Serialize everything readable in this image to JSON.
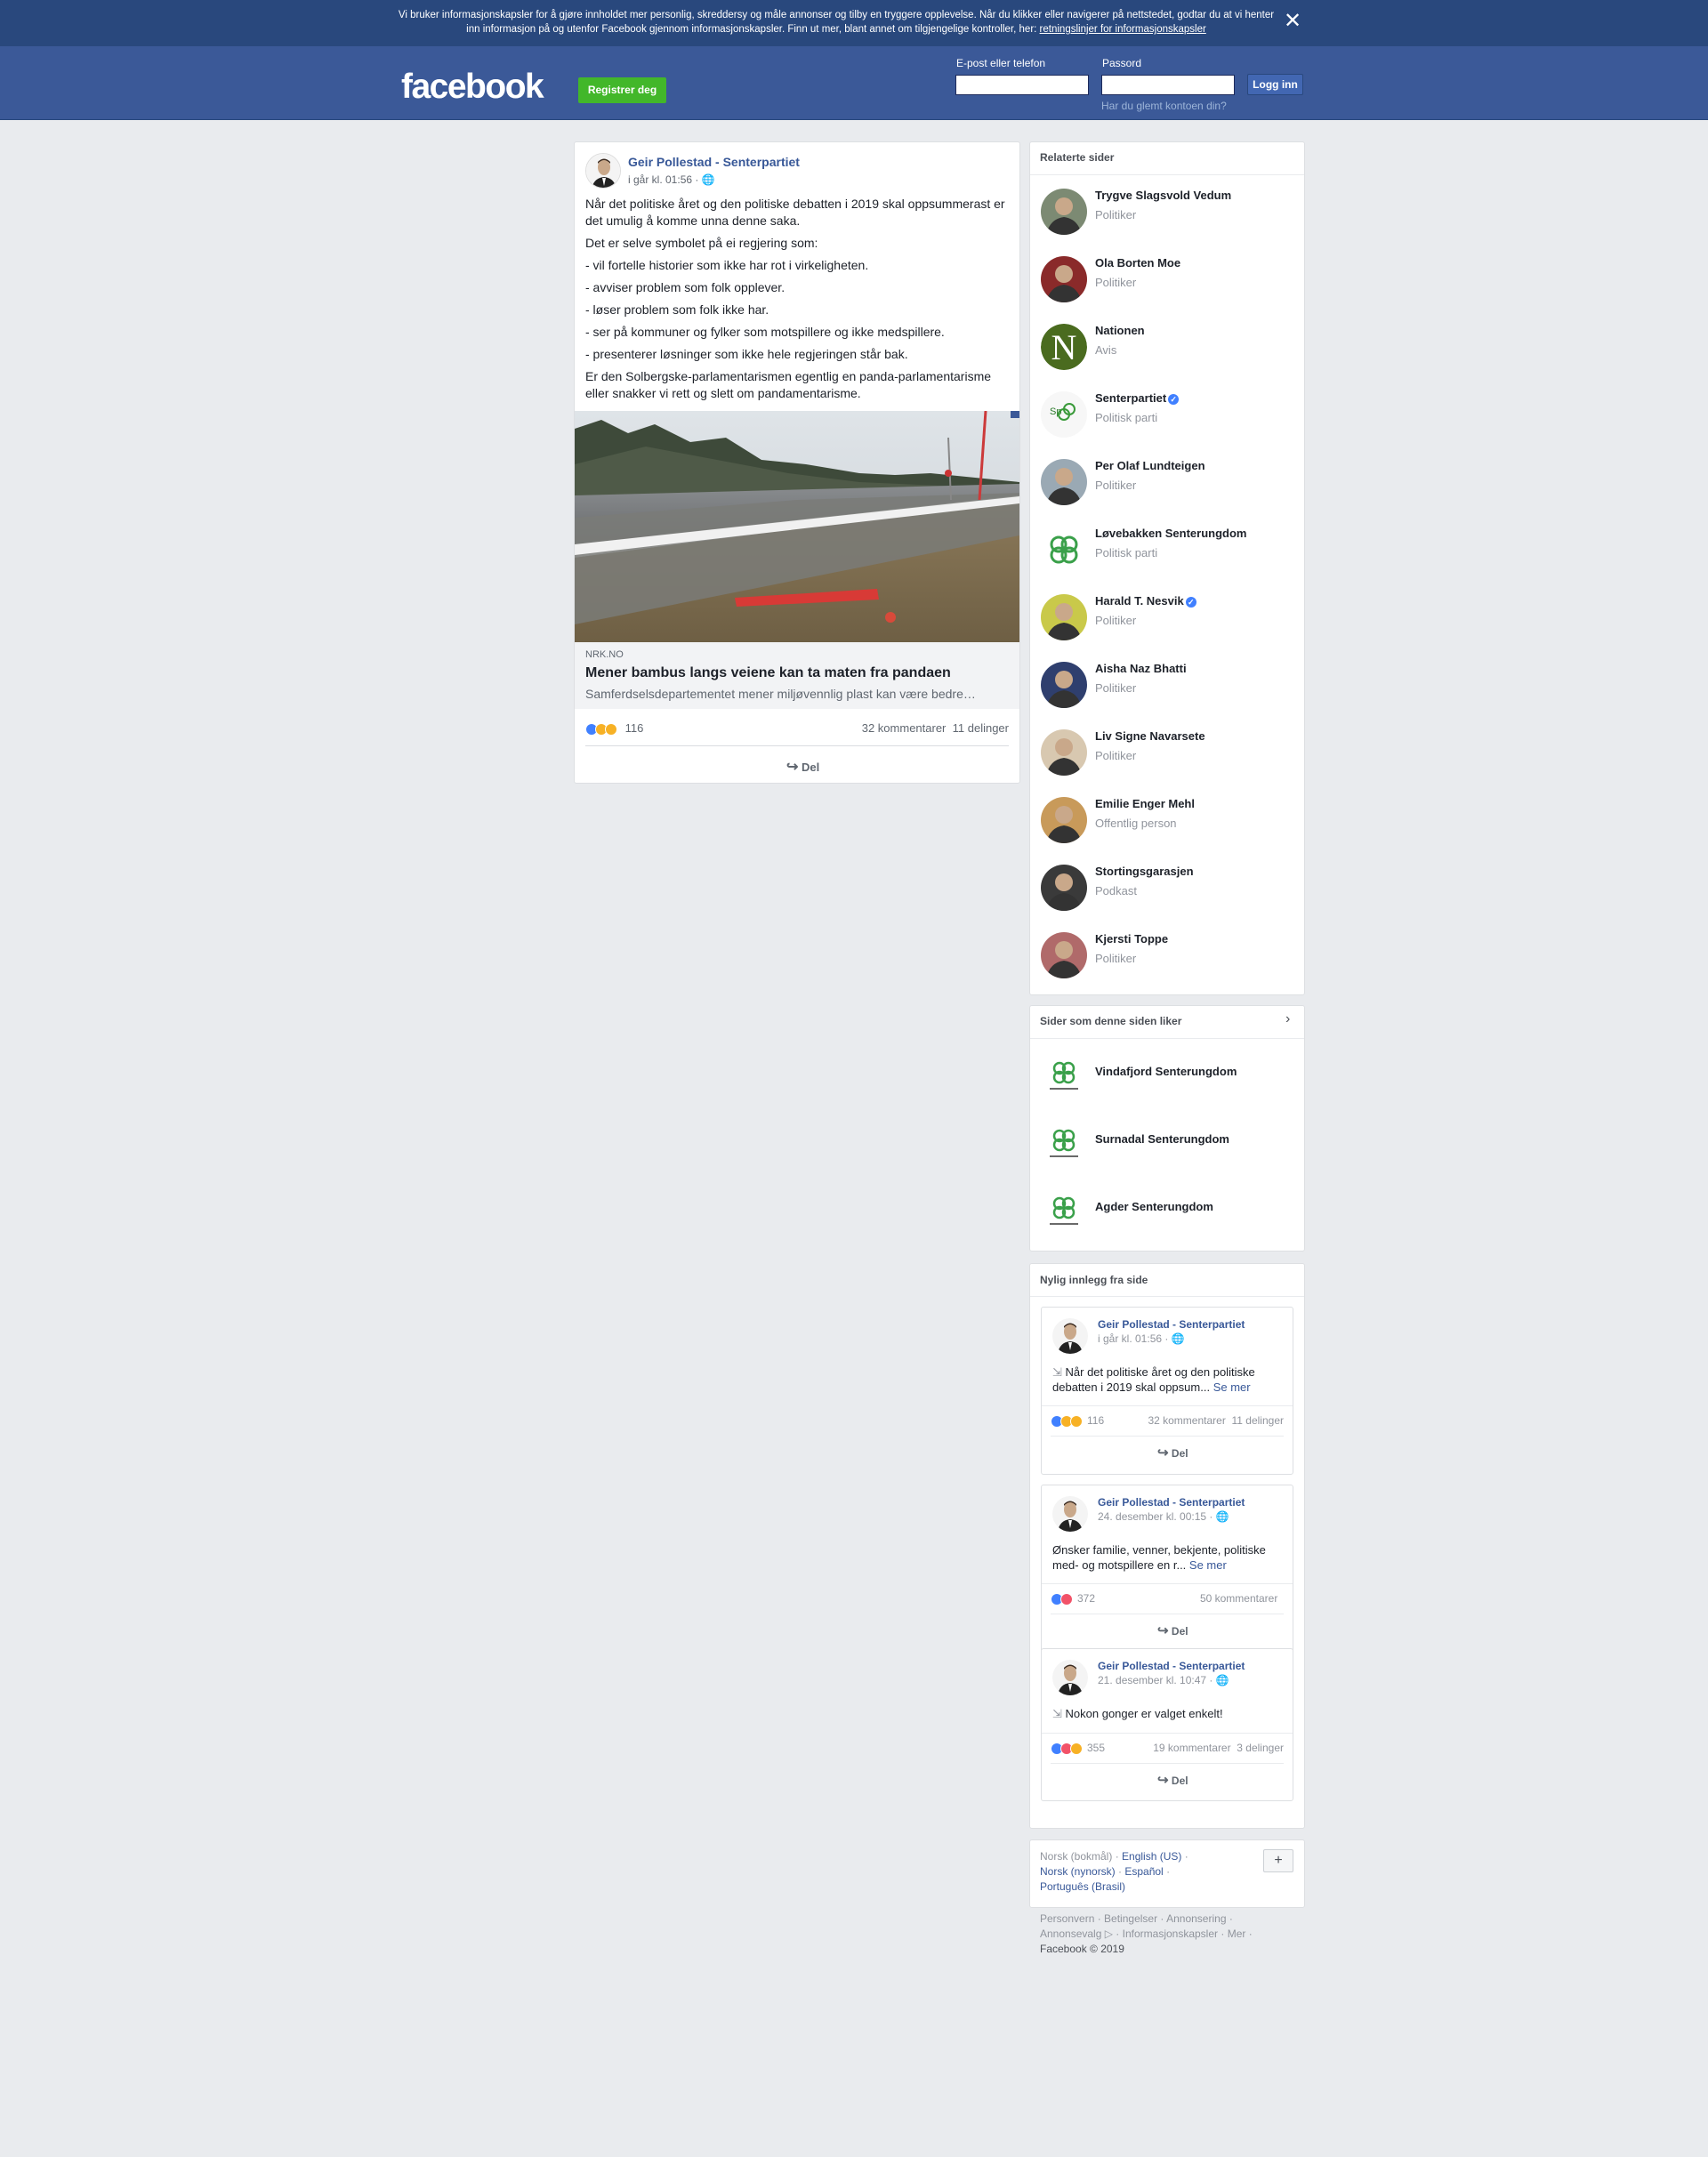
{
  "cookie_banner": {
    "text": "Vi bruker informasjonskapsler for å gjøre innholdet mer personlig, skreddersy og måle annonser og tilby en tryggere opplevelse. Når du klikker eller navigerer på nettstedet, godtar du at vi henter inn informasjon på og utenfor Facebook gjennom informasjonskapsler. Finn ut mer, blant annet om tilgjengelige kontroller, her: ",
    "link": "retningslinjer for informasjonskapsler"
  },
  "header": {
    "logo": "facebook",
    "register": "Registrer deg",
    "email_label": "E-post eller telefon",
    "password_label": "Passord",
    "login": "Logg inn",
    "forgot": "Har du glemt kontoen din?"
  },
  "post": {
    "author": "Geir Pollestad - Senterpartiet",
    "time": "i går kl. 01:56 · ",
    "paragraphs": [
      "Når det politiske året og den politiske debatten i 2019 skal oppsummerast er det umulig å komme unna denne saka.",
      "Det er selve symbolet på ei regjering som:",
      "- vil fortelle historier som ikke har rot i virkeligheten.",
      "- avviser problem som folk opplever.",
      "- løser problem som folk ikke har.",
      "- ser på kommuner og fylker som motspillere og ikke medspillere.",
      "- presenterer løsninger som ikke hele regjeringen står bak.",
      "Er den Solbergske-parlamentarismen egentlig en panda-parlamentarisme eller snakker vi rett og slett om pandamentarisme."
    ],
    "link": {
      "domain": "NRK.NO",
      "title": "Mener bambus langs veiene kan ta maten fra pandaen",
      "desc": "Samferdselsdepartementet mener miljøvennlig plast kan være bedre…"
    },
    "reactions": "116",
    "comments": "32 kommentarer",
    "shares": "11 delinger",
    "share_button": "Del"
  },
  "related": {
    "title": "Relaterte sider",
    "items": [
      {
        "name": "Trygve Slagsvold Vedum",
        "category": "Politiker",
        "color": "#7c8a73"
      },
      {
        "name": "Ola Borten Moe",
        "category": "Politiker",
        "color": "#8a2a2a"
      },
      {
        "name": "Nationen",
        "category": "Avis",
        "color": "#4a6b1f"
      },
      {
        "name": "Senterpartiet",
        "category": "Politisk parti",
        "color": "#f2f2f2"
      },
      {
        "name": "Per Olaf Lundteigen",
        "category": "Politiker",
        "color": "#9aa9b4"
      },
      {
        "name": "Løvebakken Senterungdom",
        "category": "Politisk parti",
        "color": "#ffffff"
      },
      {
        "name": "Harald T. Nesvik",
        "category": "Politiker",
        "color": "#c9c94a"
      },
      {
        "name": "Aisha Naz Bhatti",
        "category": "Politiker",
        "color": "#2f3f6e"
      },
      {
        "name": "Liv Signe Navarsete",
        "category": "Politiker",
        "color": "#d8c8b0"
      },
      {
        "name": "Emilie Enger Mehl",
        "category": "Offentlig person",
        "color": "#c89a5a"
      },
      {
        "name": "Stortingsgarasjen",
        "category": "Podkast",
        "color": "#3a3a3a"
      },
      {
        "name": "Kjersti Toppe",
        "category": "Politiker",
        "color": "#b06a6a"
      }
    ]
  },
  "liked_pages": {
    "title": "Sider som denne siden liker",
    "items": [
      {
        "name": "Vindafjord Senterungdom"
      },
      {
        "name": "Surnadal Senterungdom"
      },
      {
        "name": "Agder Senterungdom"
      }
    ]
  },
  "recent": {
    "title": "Nylig innlegg fra side",
    "posts": [
      {
        "author": "Geir Pollestad - Senterpartiet",
        "time": "i går kl. 01:56 · ",
        "text": " Når det politiske året og den politiske debatten i 2019 skal oppsum...",
        "see_more": "Se mer",
        "count": "116",
        "comments": "32 kommentarer",
        "shares": "11 delinger",
        "share": "Del"
      },
      {
        "author": "Geir Pollestad - Senterpartiet",
        "time": "24. desember kl. 00:15 · ",
        "text": "Ønsker familie, venner, bekjente, politiske med- og motspillere en r...",
        "see_more": "Se mer",
        "count": "372",
        "comments": "50 kommentarer",
        "shares": "",
        "share": "Del"
      },
      {
        "author": "Geir Pollestad - Senterpartiet",
        "time": "21. desember kl. 10:47 · ",
        "text": " Nokon gonger er valget enkelt!",
        "see_more": "",
        "count": "355",
        "comments": "19 kommentarer",
        "shares": "3 delinger",
        "share": "Del"
      }
    ]
  },
  "languages": {
    "current": "Norsk (bokmål)",
    "others": [
      "English (US)",
      "Norsk (nynorsk)",
      "Español",
      "Português (Brasil)"
    ],
    "add": "+"
  },
  "footer": {
    "links": [
      "Personvern",
      "Betingelser",
      "Annonsering",
      "Annonsevalg",
      "Informasjonskapsler",
      "Mer"
    ],
    "copyright": "Facebook © 2019"
  }
}
